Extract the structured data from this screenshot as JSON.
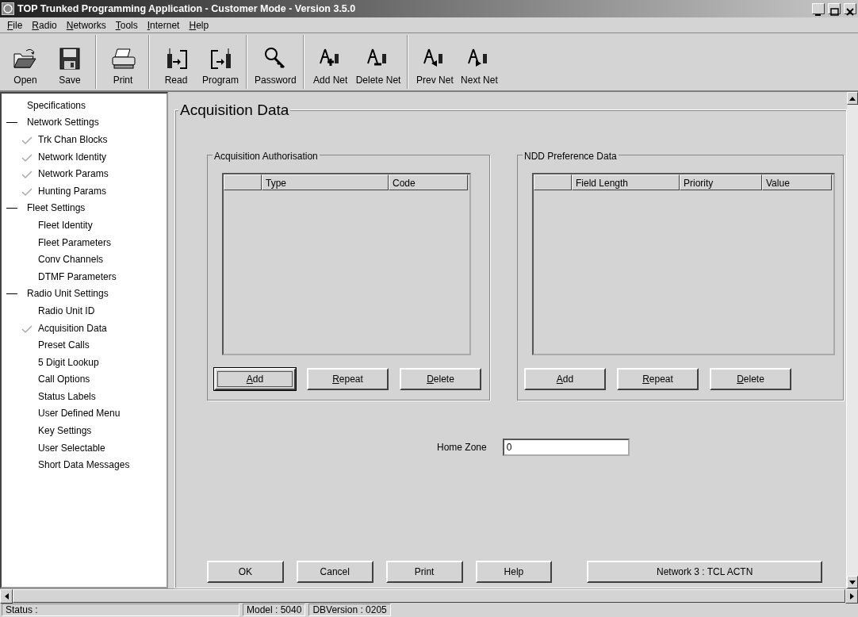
{
  "window": {
    "title": "TOP Trunked Programming Application - Customer Mode - Version 3.5.0"
  },
  "menu": [
    "File",
    "Radio",
    "Networks",
    "Tools",
    "Internet",
    "Help"
  ],
  "toolbar": [
    [
      {
        "label": "Open",
        "kind": "open"
      },
      {
        "label": "Save",
        "kind": "save"
      }
    ],
    [
      {
        "label": "Print",
        "kind": "print"
      }
    ],
    [
      {
        "label": "Read",
        "kind": "read"
      },
      {
        "label": "Program",
        "kind": "program"
      }
    ],
    [
      {
        "label": "Password",
        "kind": "key"
      }
    ],
    [
      {
        "label": "Add Net",
        "kind": "addnet"
      },
      {
        "label": "Delete Net",
        "kind": "deletenet"
      }
    ],
    [
      {
        "label": "Prev Net",
        "kind": "prevnet"
      },
      {
        "label": "Next Net",
        "kind": "nextnet"
      }
    ]
  ],
  "tree": [
    {
      "label": "Specifications"
    },
    {
      "label": "Network Settings",
      "expanded": true,
      "children": [
        {
          "label": "Trk Chan Blocks",
          "checked": true
        },
        {
          "label": "Network Identity",
          "checked": true
        },
        {
          "label": "Network Params",
          "checked": true
        },
        {
          "label": "Hunting Params",
          "checked": true
        }
      ]
    },
    {
      "label": "Fleet Settings",
      "expanded": true,
      "children": [
        {
          "label": "Fleet Identity",
          "checked": false
        },
        {
          "label": "Fleet Parameters",
          "checked": false
        },
        {
          "label": "Conv Channels",
          "checked": false
        },
        {
          "label": "DTMF Parameters",
          "checked": false
        }
      ]
    },
    {
      "label": "Radio Unit Settings",
      "expanded": true,
      "children": [
        {
          "label": "Radio Unit ID",
          "checked": false
        },
        {
          "label": "Acquisition Data",
          "checked": true
        },
        {
          "label": "Preset Calls",
          "checked": false
        },
        {
          "label": "5 Digit Lookup",
          "checked": false
        },
        {
          "label": "Call Options",
          "checked": false
        },
        {
          "label": "Status Labels",
          "checked": false
        },
        {
          "label": "User Defined Menu",
          "checked": false
        },
        {
          "label": "Key Settings",
          "checked": false
        },
        {
          "label": "User Selectable",
          "checked": false
        },
        {
          "label": "Short Data Messages",
          "checked": false
        }
      ]
    }
  ],
  "page": {
    "title": "Acquisition Data",
    "groups": [
      {
        "title": "Acquisition Authorisation",
        "columns": [
          "Type",
          "Code"
        ],
        "buttons": [
          {
            "label": "Add",
            "focused": true
          },
          {
            "label": "Repeat",
            "focused": false
          },
          {
            "label": "Delete",
            "focused": false
          }
        ]
      },
      {
        "title": "NDD Preference Data",
        "columns": [
          "Field Length",
          "Priority",
          "Value"
        ],
        "buttons": [
          {
            "label": "Add",
            "focused": false
          },
          {
            "label": "Repeat",
            "focused": false
          },
          {
            "label": "Delete",
            "focused": false
          }
        ]
      }
    ],
    "home_zone": {
      "label": "Home Zone",
      "value": "0"
    },
    "bottom_buttons": [
      "OK",
      "Cancel",
      "Print",
      "Help"
    ],
    "network_button": "Network 3 : TCL ACTN"
  },
  "status_bar": [
    "Status :",
    "Model : 5040",
    "DBVersion : 0205"
  ]
}
